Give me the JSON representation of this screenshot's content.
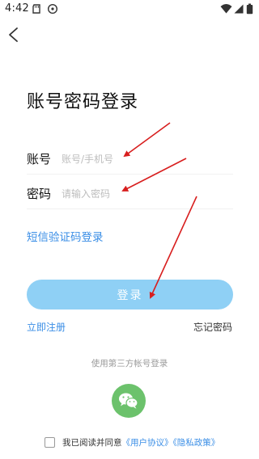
{
  "status_bar": {
    "time": "4:42",
    "left_icons": [
      "sd-card-icon",
      "clock-icon"
    ],
    "right_icons": [
      "wifi-icon",
      "signal-icon",
      "battery-icon"
    ]
  },
  "nav": {
    "back_icon": "chevron-left-icon"
  },
  "title": "账号密码登录",
  "form": {
    "account": {
      "label": "账号",
      "placeholder": "账号/手机号",
      "value": ""
    },
    "password": {
      "label": "密码",
      "placeholder": "请输入密码",
      "value": ""
    },
    "sms_login_link": "短信验证码登录",
    "submit_label": "登录"
  },
  "links": {
    "register": "立即注册",
    "forgot_password": "忘记密码"
  },
  "third_party": {
    "caption": "使用第三方帐号登录",
    "wechat_icon": "wechat-icon"
  },
  "agreement": {
    "prefix": "我已阅读并同意",
    "user_agreement": "《用户协议》",
    "privacy_policy": "《隐私政策》",
    "checked": false
  },
  "colors": {
    "accent": "#3a8ee6",
    "button_bg": "#8fd0f5",
    "wechat": "#6cc26c",
    "annotation_arrow": "#d81e1e"
  }
}
